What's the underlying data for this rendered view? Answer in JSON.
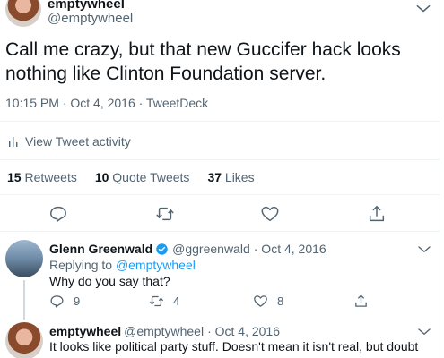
{
  "tweet": {
    "display_name": "emptywheel",
    "handle": "@emptywheel",
    "text": "Call me crazy, but that new Guccifer hack looks nothing like Clinton Foundation server.",
    "meta": "10:15 PM · Oct 4, 2016 · TweetDeck",
    "activity_label": "View Tweet activity",
    "stats": {
      "retweets_count": "15",
      "retweets_label": "Retweets",
      "quotes_count": "10",
      "quotes_label": "Quote Tweets",
      "likes_count": "37",
      "likes_label": "Likes"
    }
  },
  "replies": [
    {
      "display_name": "Glenn Greenwald",
      "handle": "@ggreenwald",
      "date": "· Oct 4, 2016",
      "replying_prefix": "Replying to",
      "replying_to": "@emptywheel",
      "text": "Why do you say that?",
      "reply_count": "9",
      "retweet_count": "4",
      "like_count": "8"
    },
    {
      "display_name": "emptywheel",
      "handle": "@emptywheel",
      "date": "· Oct 4, 2016",
      "text": "It looks like political party stuff. Doesn't mean it isn't real, but doubt it's Clinton Foundation."
    }
  ],
  "icons": {
    "reply": "reply-icon",
    "retweet": "retweet-icon",
    "like": "heart-icon",
    "share": "share-icon",
    "more": "chevron-down-icon",
    "verified": "verified-badge-icon",
    "activity": "bar-chart-icon"
  },
  "colors": {
    "accent": "#1d9bf0",
    "text": "#0f1419",
    "muted": "#536471",
    "divider": "#eff3f4"
  }
}
